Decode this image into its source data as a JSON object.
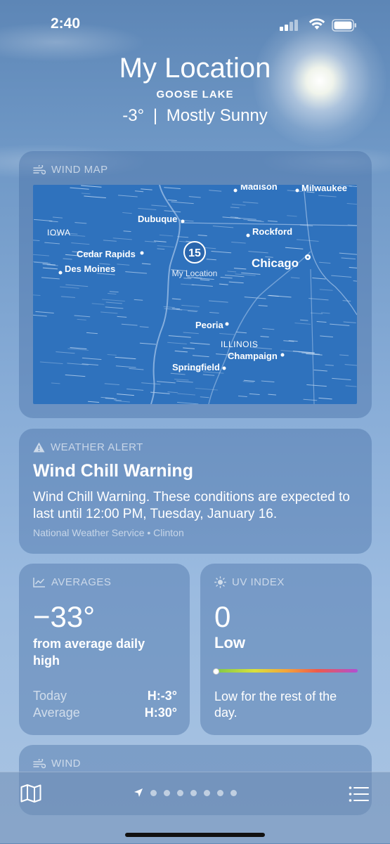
{
  "status_bar": {
    "time": "2:40"
  },
  "header": {
    "title": "My Location",
    "subtitle": "GOOSE LAKE",
    "temperature": "-3°",
    "separator": "|",
    "condition": "Mostly Sunny"
  },
  "wind_map": {
    "label": "WIND MAP",
    "marker_value": "15",
    "marker_label": "My Location",
    "places": {
      "madison": "Madison",
      "milwaukee": "Milwaukee",
      "dubuque": "Dubuque",
      "iowa": "IOWA",
      "rockford": "Rockford",
      "cedar_rapids": "Cedar Rapids",
      "des_moines": "Des Moines",
      "chicago": "Chicago",
      "peoria": "Peoria",
      "illinois": "ILLINOIS",
      "champaign": "Champaign",
      "springfield": "Springfield"
    }
  },
  "alert": {
    "label": "WEATHER ALERT",
    "title": "Wind Chill Warning",
    "body": "Wind Chill Warning. These conditions are expected to last until 12:00 PM, Tuesday, January 16.",
    "source": "National Weather Service • Clinton"
  },
  "averages": {
    "label": "AVERAGES",
    "value": "−33°",
    "description": "from average daily high",
    "rows": [
      {
        "label": "Today",
        "value": "H:-3°"
      },
      {
        "label": "Average",
        "value": "H:30°"
      }
    ]
  },
  "uv": {
    "label": "UV INDEX",
    "value": "0",
    "level": "Low",
    "level_fraction": 0,
    "note": "Low for the rest of the day."
  },
  "wind": {
    "label": "WIND"
  },
  "page_indicator": {
    "pages": 7,
    "current": "location-arrow"
  },
  "colors": {
    "map_water": "#2f72bd",
    "uv_gradient": [
      "#7cc84a",
      "#d9e13c",
      "#f4a43b",
      "#ee5a4c",
      "#b04fd3"
    ]
  }
}
